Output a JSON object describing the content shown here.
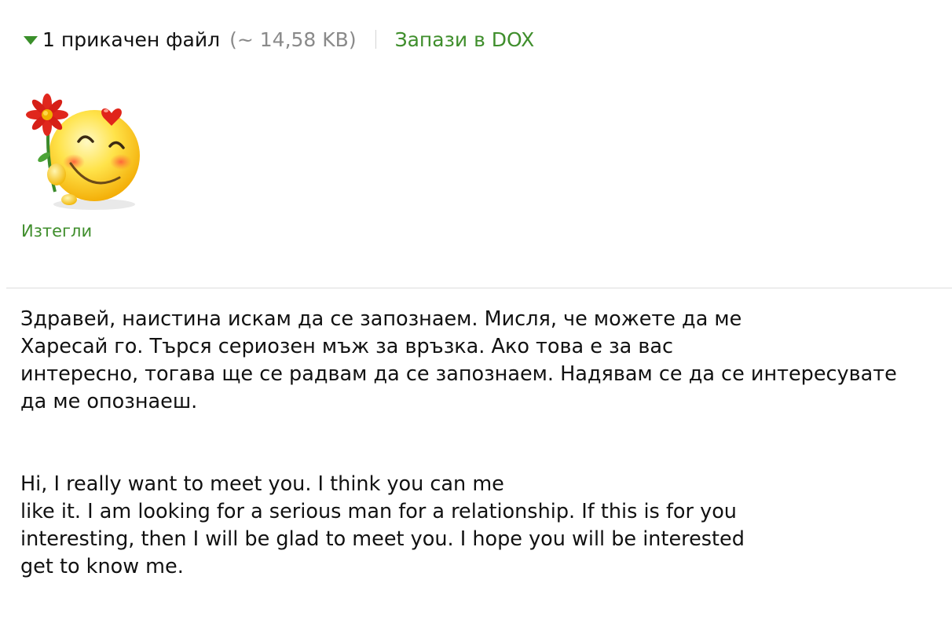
{
  "attachment": {
    "count_label": "1 прикачен файл",
    "size_label": "(~ 14,58 KB)",
    "save_label": "Запази в DOX",
    "download_label": "Изтегли",
    "thumbnail_icon": "smiley-with-flower-and-heart-icon"
  },
  "colors": {
    "link_green": "#3f8e2c",
    "arrow_green": "#3a8f2a",
    "muted_gray": "#8a8a8a"
  },
  "message": {
    "bulgarian_lines": [
      "Здравей, наистина искам да се запознаем. Мисля, че можете да ме",
      "Харесай го. Търся сериозен мъж за връзка. Ако това е за вас",
      "интересно, тогава ще се радвам да се запознаем. Надявам се да се интересувате",
      "да ме опознаеш."
    ],
    "english_lines": [
      "Hi, I really want to meet you. I think you can me",
      "like it. I am looking for a serious man for a relationship. If this is for you",
      "interesting, then I will be glad to meet you. I hope you will be interested",
      "get to know me."
    ]
  }
}
